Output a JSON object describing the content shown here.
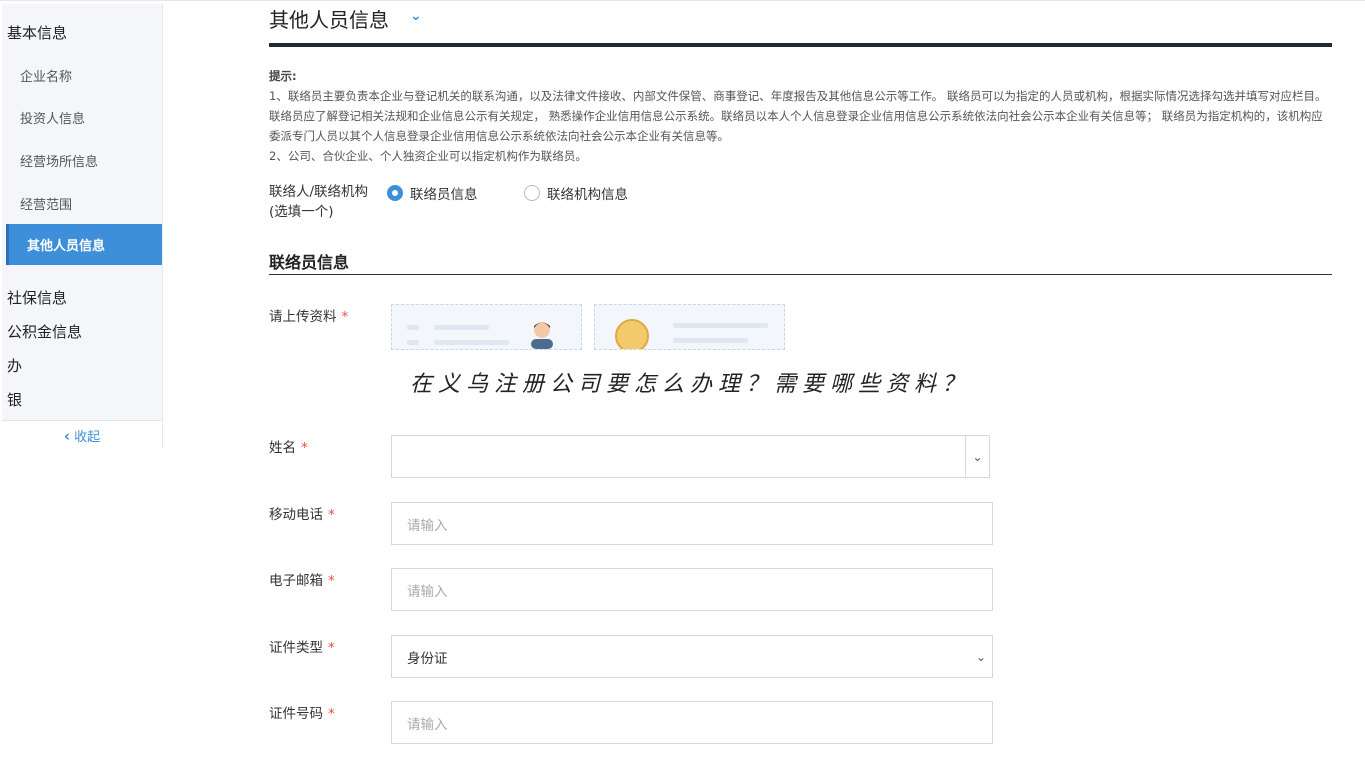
{
  "sidebar": {
    "section_basic": "基本信息",
    "items": [
      "企业名称",
      "投资人信息",
      "经营场所信息",
      "经营范围"
    ],
    "active_item": "其他人员信息",
    "section_social": "社保信息",
    "section_fund": "公积金信息",
    "truncated_1": "办",
    "truncated_2": "银",
    "collapse_label": "收起"
  },
  "main": {
    "title": "其他人员信息",
    "tip_title": "提示:",
    "tip_1": "1、联络员主要负责本企业与登记机关的联系沟通，以及法律文件接收、内部文件保管、商事登记、年度报告及其他信息公示等工作。 联络员可以为指定的人员或机构，根据实际情况选择勾选并填写对应栏目。联络员应了解登记相关法规和企业信息公示有关规定， 熟悉操作企业信用信息公示系统。联络员以本人个人信息登录企业信用信息公示系统依法向社会公示本企业有关信息等； 联络员为指定机构的，该机构应委派专门人员以其个人信息登录企业信用信息公示系统依法向社会公示本企业有关信息等。",
    "tip_2": "2、公司、合伙企业、个人独资企业可以指定机构作为联络员。",
    "contact_type_label_1": "联络人/联络机构",
    "contact_type_label_2": "(选填一个)",
    "radio_person": "联络员信息",
    "radio_org": "联络机构信息",
    "section_title": "联络员信息",
    "upload_label": "请上传资料",
    "overlay_text": "在义乌注册公司要怎么办理？需要哪些资料？",
    "name_label": "姓名",
    "mobile_label": "移动电话",
    "mobile_placeholder": "请输入",
    "email_label": "电子邮箱",
    "email_placeholder": "请输入",
    "id_type_label": "证件类型",
    "id_type_value": "身份证",
    "id_number_label": "证件号码",
    "id_number_placeholder": "请输入",
    "required_mark": "*"
  },
  "colors": {
    "accent": "#3e8fd9",
    "required": "#e74c3c",
    "title_rule": "#1f2a3a"
  }
}
